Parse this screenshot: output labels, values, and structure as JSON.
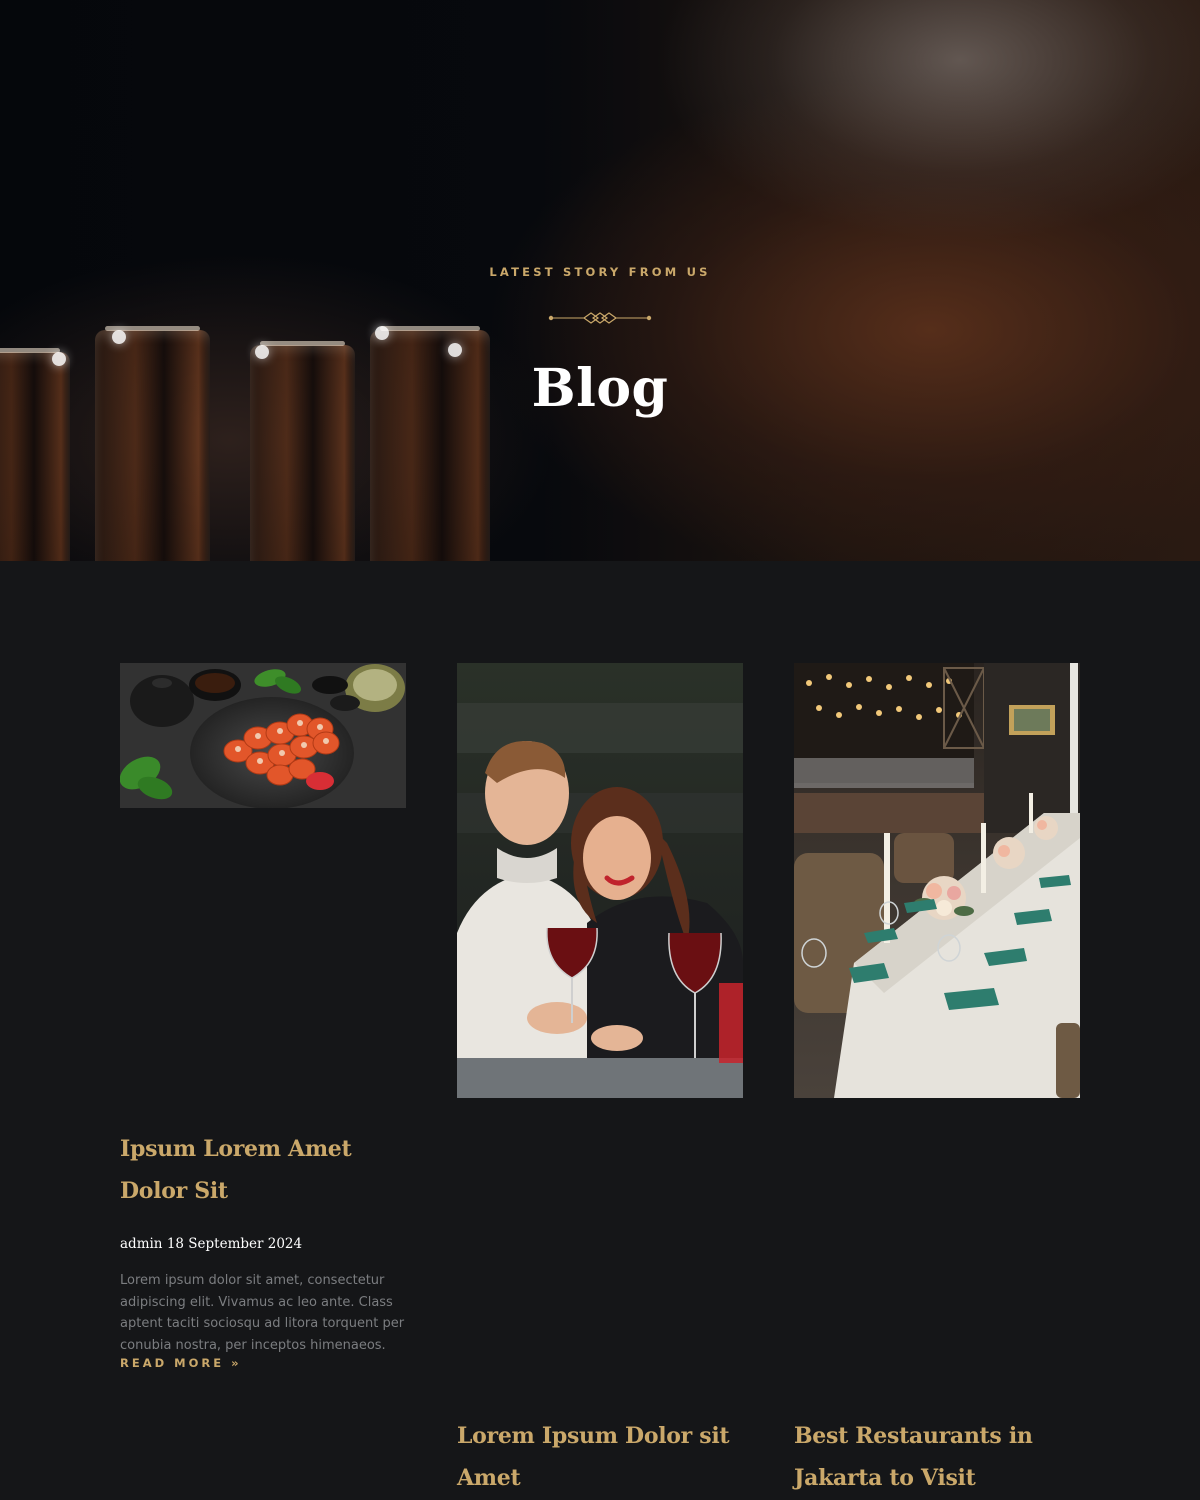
{
  "hero": {
    "eyebrow": "LATEST STORY FROM US",
    "title": "Blog"
  },
  "posts": [
    {
      "title": "Ipsum Lorem Amet Dolor Sit",
      "author": "admin",
      "date": "18 September 2024",
      "excerpt": "Lorem ipsum dolor sit amet, consectetur adipiscing elit. Vivamus ac leo ante. Class aptent taciti sociosqu ad litora torquent per conubia nostra, per inceptos himenaeos.",
      "read_more": "READ MORE »",
      "image_icon": "sushi-platter-image"
    },
    {
      "title": "Lorem Ipsum Dolor sit Amet",
      "image_icon": "couple-dining-image"
    },
    {
      "title": "Best Restaurants in Jakarta to Visit",
      "image_icon": "restaurant-table-image"
    }
  ],
  "colors": {
    "accent": "#caa86a",
    "background": "#151618",
    "excerpt_text": "#7b7d80"
  }
}
